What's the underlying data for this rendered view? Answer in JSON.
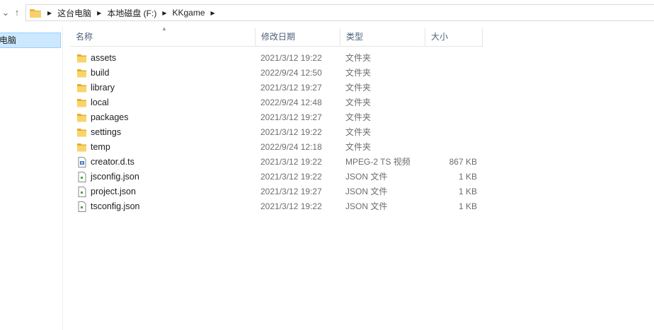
{
  "address_bar": {
    "crumbs": [
      "这台电脑",
      "本地磁盘 (F:)",
      "KKgame"
    ]
  },
  "nav_pane": {
    "selected_label": "电脑"
  },
  "columns": {
    "name": "名称",
    "date": "修改日期",
    "type": "类型",
    "size": "大小"
  },
  "files": [
    {
      "name": "assets",
      "date": "2021/3/12 19:22",
      "type": "文件夹",
      "size": "",
      "icon": "folder-icon"
    },
    {
      "name": "build",
      "date": "2022/9/24 12:50",
      "type": "文件夹",
      "size": "",
      "icon": "folder-icon"
    },
    {
      "name": "library",
      "date": "2021/3/12 19:27",
      "type": "文件夹",
      "size": "",
      "icon": "folder-icon"
    },
    {
      "name": "local",
      "date": "2022/9/24 12:48",
      "type": "文件夹",
      "size": "",
      "icon": "folder-icon"
    },
    {
      "name": "packages",
      "date": "2021/3/12 19:27",
      "type": "文件夹",
      "size": "",
      "icon": "folder-icon"
    },
    {
      "name": "settings",
      "date": "2021/3/12 19:22",
      "type": "文件夹",
      "size": "",
      "icon": "folder-icon"
    },
    {
      "name": "temp",
      "date": "2022/9/24 12:18",
      "type": "文件夹",
      "size": "",
      "icon": "folder-icon"
    },
    {
      "name": "creator.d.ts",
      "date": "2021/3/12 19:22",
      "type": "MPEG-2 TS 视频",
      "size": "867 KB",
      "icon": "video-file-icon"
    },
    {
      "name": "jsconfig.json",
      "date": "2021/3/12 19:22",
      "type": "JSON 文件",
      "size": "1 KB",
      "icon": "json-file-icon"
    },
    {
      "name": "project.json",
      "date": "2021/3/12 19:27",
      "type": "JSON 文件",
      "size": "1 KB",
      "icon": "json-file-icon"
    },
    {
      "name": "tsconfig.json",
      "date": "2021/3/12 19:22",
      "type": "JSON 文件",
      "size": "1 KB",
      "icon": "json-file-icon"
    }
  ],
  "colors": {
    "selection_bg": "#cce8ff",
    "selection_border": "#99d1ff",
    "folder_yellow": "#f4c94a",
    "header_text": "#4c607a"
  }
}
